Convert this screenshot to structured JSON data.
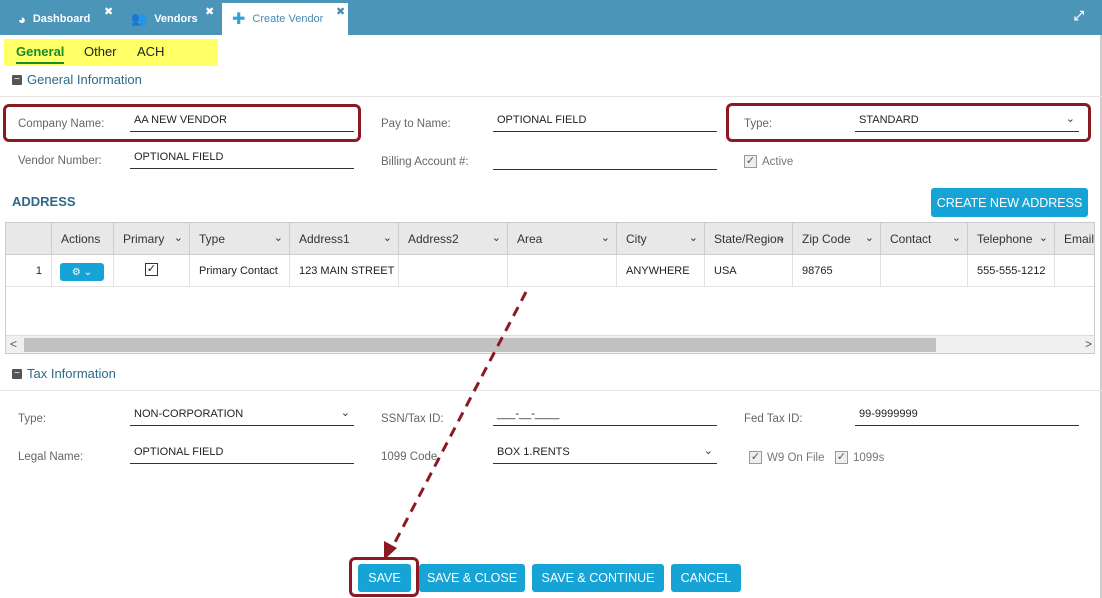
{
  "tabs": [
    {
      "label": "Dashboard",
      "icon": "dashboard-icon"
    },
    {
      "label": "Vendors",
      "icon": "users-icon"
    },
    {
      "label": "Create Vendor",
      "icon": "plus-icon"
    }
  ],
  "subtabs": [
    "General",
    "Other",
    "ACH"
  ],
  "general": {
    "title": "General Information",
    "company_name_label": "Company Name:",
    "company_name": "AA NEW VENDOR",
    "pay_to_label": "Pay to Name:",
    "pay_to": "OPTIONAL FIELD",
    "type_label": "Type:",
    "type": "STANDARD",
    "vendor_number_label": "Vendor Number:",
    "vendor_number": "OPTIONAL FIELD",
    "billing_label": "Billing Account #:",
    "billing": "",
    "active_label": "Active"
  },
  "address": {
    "title": "ADDRESS",
    "create_button": "CREATE NEW ADDRESS",
    "columns": [
      "Actions",
      "Primary",
      "Type",
      "Address1",
      "Address2",
      "Area",
      "City",
      "State/Region",
      "Zip Code",
      "Contact",
      "Telephone",
      "Email"
    ],
    "rows": [
      {
        "num": "1",
        "type": "Primary Contact",
        "address1": "123 MAIN STREET",
        "address2": "",
        "area": "",
        "city": "ANYWHERE",
        "state": "USA",
        "zip": "98765",
        "contact": "",
        "telephone": "555-555-1212",
        "email": ""
      }
    ]
  },
  "tax": {
    "title": "Tax Information",
    "type_label": "Type:",
    "type": "NON-CORPORATION",
    "ssn_label": "SSN/Tax ID:",
    "ssn": "___-__-____",
    "fed_label": "Fed Tax ID:",
    "fed": "99-9999999",
    "legal_label": "Legal Name:",
    "legal": "OPTIONAL FIELD",
    "code_label": "1099 Code",
    "code": "BOX 1.RENTS",
    "w9_label": "W9 On File",
    "f1099_label": "1099s"
  },
  "buttons": {
    "save": "SAVE",
    "save_close": "SAVE & CLOSE",
    "save_continue": "SAVE & CONTINUE",
    "cancel": "CANCEL"
  },
  "colors": {
    "accent": "#16a4d6",
    "tabbar": "#4a95b8",
    "highlight": "#8b1a24",
    "subtab_bg": "#ffff66"
  }
}
